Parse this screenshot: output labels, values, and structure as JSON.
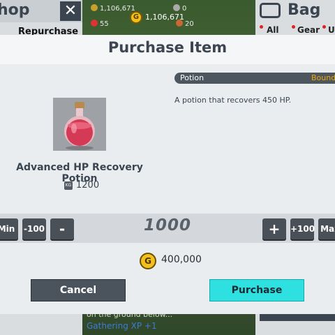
{
  "background": {
    "shop_title": "hop",
    "close_label": "✕",
    "repurchase_tab": "Repurchase",
    "bag_title": "Bag",
    "bag_tabs": [
      "All",
      "Gear",
      "U"
    ],
    "hud": {
      "silver_total": "1,106,671",
      "gold_total": "1,106,671",
      "stat_a": "0",
      "stat_b": "55",
      "stat_c": "20",
      "gold_icon_letter": "G"
    },
    "log_text": "on the ground below...",
    "log_xp": "Gathering XP +1"
  },
  "dialog": {
    "title": "Purchase Item",
    "item_name": "Advanced HP Recovery Potion",
    "weight_icon_text": "KG",
    "weight": "1200",
    "type_label": "Potion",
    "bound_label": "Bound",
    "description": "A potion that recovers 450 HP.",
    "quantity": {
      "min_label": "Min",
      "minus100_label": "-100",
      "minus_label": "-",
      "value": "1000",
      "plus_label": "+",
      "plus100_label": "+100",
      "max_label": "Max"
    },
    "price_icon_letter": "G",
    "price": "400,000",
    "cancel_label": "Cancel",
    "purchase_label": "Purchase"
  },
  "colors": {
    "purchase_button": "#2ee0e0",
    "cancel_button": "#4b545c",
    "bound_text": "#f2a800",
    "gold_coin": "#f2c01e"
  }
}
